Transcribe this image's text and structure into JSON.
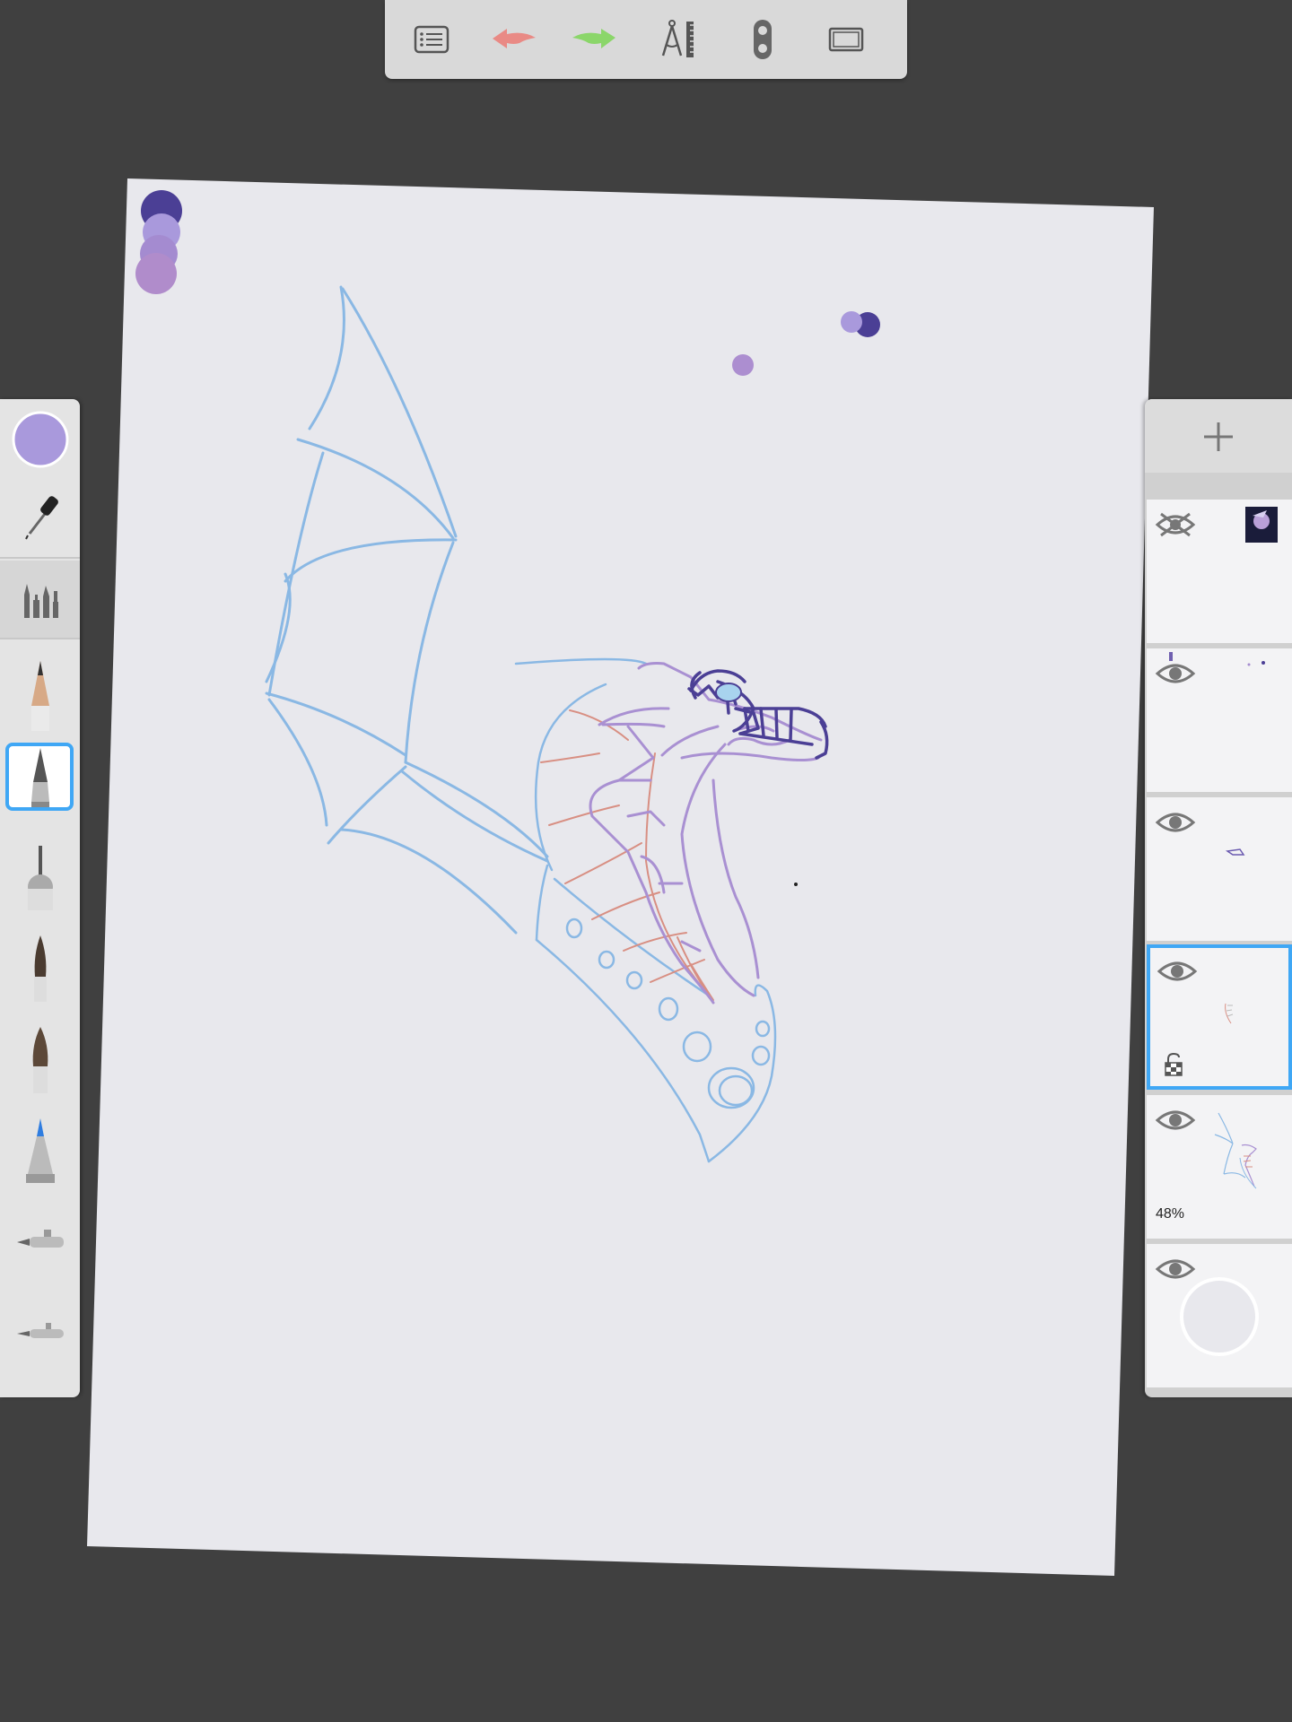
{
  "toolbar": {
    "buttons": [
      {
        "name": "menu-list-button",
        "icon": "list-icon"
      },
      {
        "name": "undo-button",
        "icon": "undo-arrow-icon",
        "color": "#e98a85"
      },
      {
        "name": "redo-button",
        "icon": "redo-arrow-icon",
        "color": "#8bd66a"
      },
      {
        "name": "guides-button",
        "icon": "compass-ruler-icon"
      },
      {
        "name": "symmetry-button",
        "icon": "symmetry-icon"
      },
      {
        "name": "fullscreen-button",
        "icon": "frame-icon"
      }
    ]
  },
  "palette": {
    "current_color": "#a999dc",
    "tools": [
      "color-swatch",
      "eyedropper-icon",
      "brush-library-icon",
      "pencil-icon",
      "ballpoint-pen-icon",
      "marker-icon",
      "paintbrush-icon",
      "flat-brush-icon",
      "felt-tip-icon",
      "airbrush-icon",
      "airbrush-small-icon"
    ],
    "selected_tool": "ballpoint-pen-icon"
  },
  "canvas": {
    "paper_color": "#e8e8ed",
    "stroke_colors": {
      "wing": "#8ab8e4",
      "body": "#a990d2",
      "belly": "#d88f83",
      "outline": "#4b3f95"
    },
    "color_history": [
      "#4b3f95",
      "#a999dc",
      "#a48bd0",
      "#b08ccb"
    ]
  },
  "layers": {
    "add_label": "+",
    "items": [
      {
        "name": "layer-1",
        "visible": false
      },
      {
        "name": "layer-2",
        "visible": true
      },
      {
        "name": "layer-3",
        "visible": true
      },
      {
        "name": "layer-4",
        "visible": true,
        "active": true,
        "locked": false
      },
      {
        "name": "layer-5",
        "visible": true,
        "opacity": "48%"
      },
      {
        "name": "layer-background",
        "visible": true
      }
    ]
  }
}
